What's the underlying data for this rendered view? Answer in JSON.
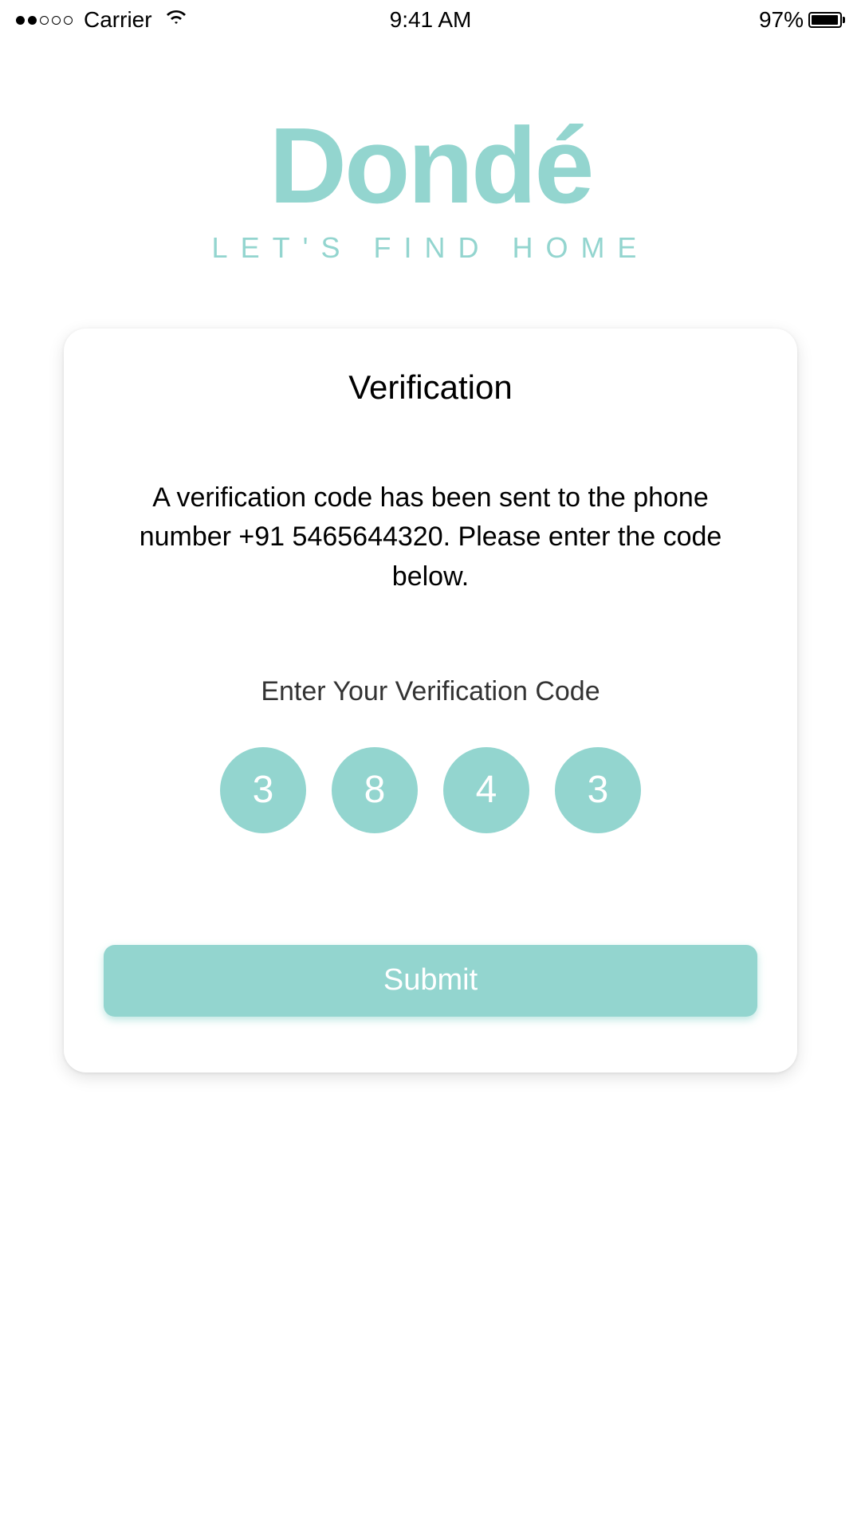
{
  "statusBar": {
    "carrier": "Carrier",
    "time": "9:41 AM",
    "batteryPercent": "97%"
  },
  "logo": {
    "title": "Dondé",
    "subtitle": "LET'S FIND HOME"
  },
  "card": {
    "title": "Verification",
    "message": "A verification code has been sent to the phone number +91 5465644320. Please enter the code below.",
    "codeLabel": "Enter Your Verification Code",
    "codeDigits": [
      "3",
      "8",
      "4",
      "3"
    ],
    "submitLabel": "Submit"
  }
}
